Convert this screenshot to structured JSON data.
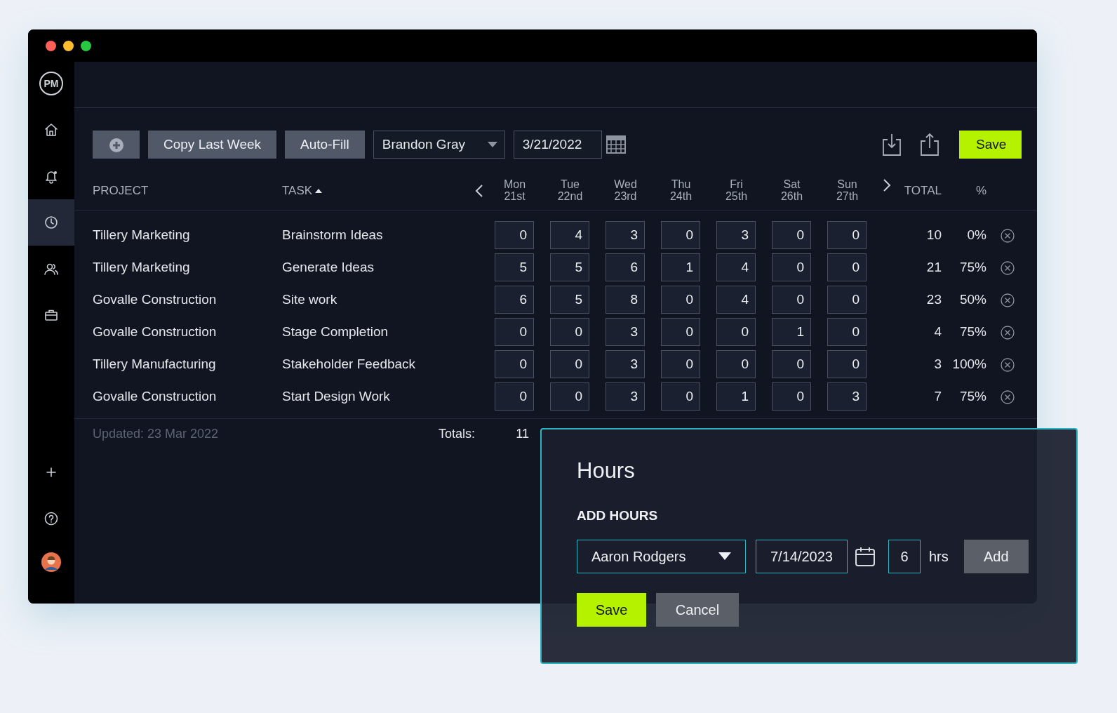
{
  "sidebar": {
    "logo": "PM",
    "items": [
      {
        "kind": "home",
        "selected": false
      },
      {
        "kind": "bell",
        "selected": false
      },
      {
        "kind": "clock",
        "selected": true
      },
      {
        "kind": "users",
        "selected": false
      },
      {
        "kind": "briefcase",
        "selected": false
      }
    ],
    "bottom": [
      {
        "kind": "plus"
      },
      {
        "kind": "help"
      },
      {
        "kind": "avatar"
      }
    ]
  },
  "toolbar": {
    "buttons": [
      "Copy Last Week",
      "Auto-Fill"
    ],
    "person": "Brandon Gray",
    "date": "3/21/2022",
    "save": "Save"
  },
  "columns": {
    "project": "PROJECT",
    "task": "TASK",
    "days": [
      {
        "day": "Mon",
        "date": "21st"
      },
      {
        "day": "Tue",
        "date": "22nd"
      },
      {
        "day": "Wed",
        "date": "23rd"
      },
      {
        "day": "Thu",
        "date": "24th"
      },
      {
        "day": "Fri",
        "date": "25th"
      },
      {
        "day": "Sat",
        "date": "26th"
      },
      {
        "day": "Sun",
        "date": "27th"
      }
    ],
    "total": "TOTAL",
    "percent": "%"
  },
  "rows": [
    {
      "project": "Tillery Marketing",
      "task": "Brainstorm Ideas",
      "hours": [
        "0",
        "4",
        "3",
        "0",
        "3",
        "0",
        "0"
      ],
      "total": "10",
      "percent": "0%"
    },
    {
      "project": "Tillery Marketing",
      "task": "Generate Ideas",
      "hours": [
        "5",
        "5",
        "6",
        "1",
        "4",
        "0",
        "0"
      ],
      "total": "21",
      "percent": "75%"
    },
    {
      "project": "Govalle Construction",
      "task": "Site work",
      "hours": [
        "6",
        "5",
        "8",
        "0",
        "4",
        "0",
        "0"
      ],
      "total": "23",
      "percent": "50%"
    },
    {
      "project": "Govalle Construction",
      "task": "Stage Completion",
      "hours": [
        "0",
        "0",
        "3",
        "0",
        "0",
        "1",
        "0"
      ],
      "total": "4",
      "percent": "75%"
    },
    {
      "project": "Tillery Manufacturing",
      "task": "Stakeholder Feedback",
      "hours": [
        "0",
        "0",
        "3",
        "0",
        "0",
        "0",
        "0"
      ],
      "total": "3",
      "percent": "100%"
    },
    {
      "project": "Govalle Construction",
      "task": "Start Design Work",
      "hours": [
        "0",
        "0",
        "3",
        "0",
        "1",
        "0",
        "3"
      ],
      "total": "7",
      "percent": "75%"
    }
  ],
  "footer": {
    "updated": "Updated: 23 Mar 2022",
    "totals_label": "Totals:",
    "totals": [
      "11"
    ]
  },
  "dialog": {
    "title": "Hours",
    "section": "ADD HOURS",
    "person": "Aaron Rodgers",
    "date": "7/14/2023",
    "hours": "6",
    "unit": "hrs",
    "add": "Add",
    "save": "Save",
    "cancel": "Cancel"
  }
}
